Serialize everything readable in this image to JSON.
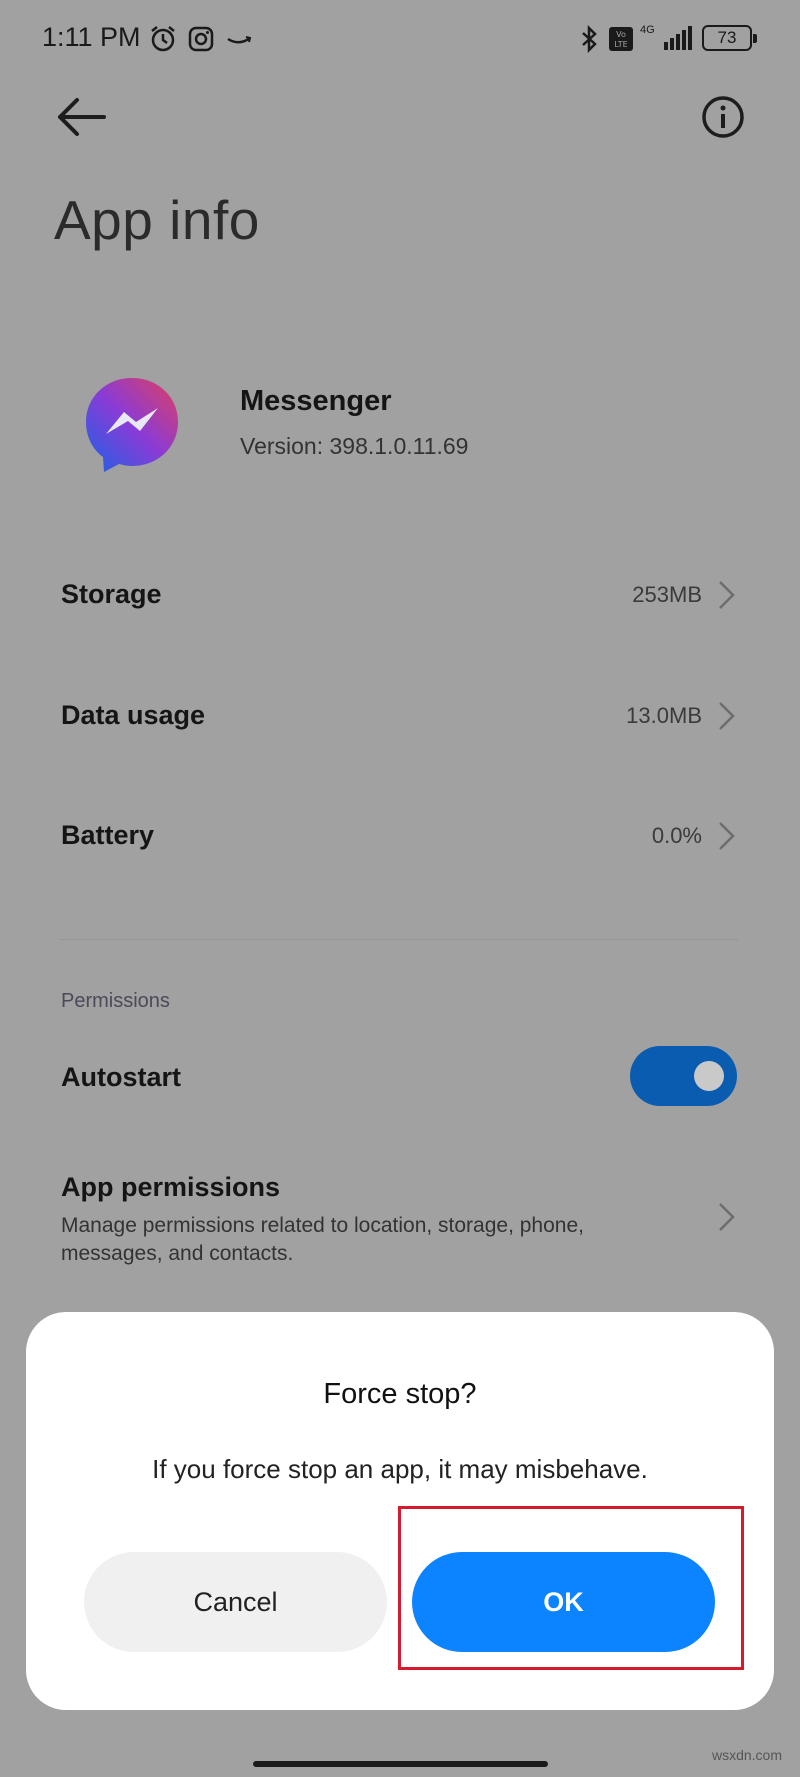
{
  "status_bar": {
    "time": "1:11 PM",
    "network_label": "4G",
    "battery_level": "73",
    "icons": [
      "alarm-icon",
      "instagram-icon",
      "amazon-icon",
      "bluetooth-icon",
      "volte-icon",
      "signal-icon",
      "battery-icon"
    ]
  },
  "header": {
    "title": "App info",
    "back_icon": "back-arrow-icon",
    "info_icon": "info-icon"
  },
  "app": {
    "name": "Messenger",
    "version": "Version: 398.1.0.11.69",
    "icon": "messenger-icon"
  },
  "rows": [
    {
      "label": "Storage",
      "value": "253MB"
    },
    {
      "label": "Data usage",
      "value": "13.0MB"
    },
    {
      "label": "Battery",
      "value": "0.0%"
    }
  ],
  "permissions": {
    "section_label": "Permissions",
    "autostart_label": "Autostart",
    "autostart_enabled": true,
    "app_permissions_label": "App permissions",
    "app_permissions_desc": "Manage permissions related to location, storage, phone, messages, and contacts."
  },
  "dialog": {
    "title": "Force stop?",
    "message": "If you force stop an app, it may misbehave.",
    "cancel_label": "Cancel",
    "ok_label": "OK"
  },
  "watermark": "wsxdn.com",
  "colors": {
    "scrim": "#a1a1a1",
    "toggle_on": "#0a5cb0",
    "ok_button": "#0d84ff",
    "highlight": "#d51c2e"
  }
}
